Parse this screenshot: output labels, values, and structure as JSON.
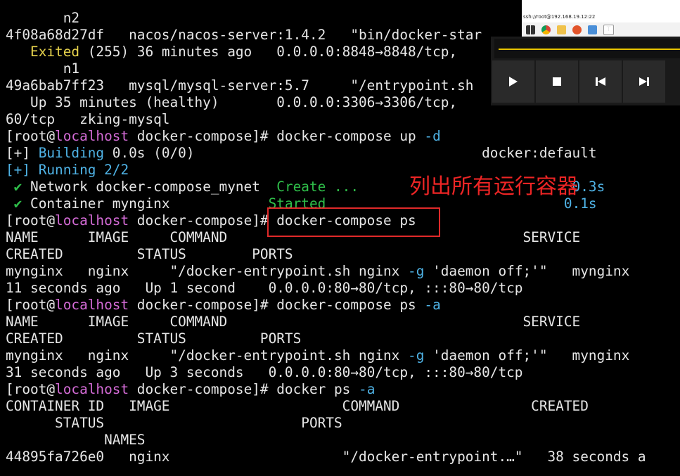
{
  "terminal": {
    "lines": [
      [
        {
          "t": "       n2",
          "c": "c-white"
        }
      ],
      [
        {
          "t": "4f08a68d27df   nacos/nacos-server:1.4.2   \"bin/docker-star",
          "c": "c-white"
        }
      ],
      [
        {
          "t": "   ",
          "c": "c-white"
        },
        {
          "t": "Exited",
          "c": "c-yellow"
        },
        {
          "t": " (255) 36 minutes ago   0.0.0.0:8848→8848/tcp, ",
          "c": "c-white"
        }
      ],
      [
        {
          "t": "       n1",
          "c": "c-white"
        }
      ],
      [
        {
          "t": "49a6bab7ff23   mysql/mysql-server:5.7     \"/entrypoint.sh",
          "c": "c-white"
        }
      ],
      [
        {
          "t": "   Up 35 minutes (healthy)       0.0.0.0:3306→3306/tcp, ",
          "c": "c-white"
        }
      ],
      [
        {
          "t": "60/tcp   zking-mysql",
          "c": "c-white"
        }
      ],
      [
        {
          "t": "[root@",
          "c": "c-prompt"
        },
        {
          "t": "localhost",
          "c": "c-magenta"
        },
        {
          "t": " docker-compose]# docker-compose up ",
          "c": "c-prompt"
        },
        {
          "t": "-d",
          "c": "c-cyan"
        }
      ],
      [
        {
          "t": "[+] ",
          "c": "c-white"
        },
        {
          "t": "Building",
          "c": "c-cyan"
        },
        {
          "t": " 0.0s (0/0)                                   docker:default",
          "c": "c-white"
        }
      ],
      [
        {
          "t": "[+] Running 2/2",
          "c": "c-cyan"
        }
      ],
      [
        {
          "t": " ✔ ",
          "c": "c-green"
        },
        {
          "t": "Network docker-compose_mynet  ",
          "c": "c-white"
        },
        {
          "t": "Create ...",
          "c": "c-green"
        },
        {
          "t": "                          ",
          "c": "c-white"
        },
        {
          "t": "0.3s",
          "c": "c-cyan"
        }
      ],
      [
        {
          "t": " ✔ ",
          "c": "c-green"
        },
        {
          "t": "Container mynginx            ",
          "c": "c-white"
        },
        {
          "t": "Started",
          "c": "c-green"
        },
        {
          "t": "                             ",
          "c": "c-white"
        },
        {
          "t": "0.1s",
          "c": "c-cyan"
        }
      ],
      [
        {
          "t": "[root@",
          "c": "c-prompt"
        },
        {
          "t": "localhost",
          "c": "c-magenta"
        },
        {
          "t": " docker-compose]# docker-compose ps",
          "c": "c-prompt"
        }
      ],
      [
        {
          "t": "NAME      IMAGE     COMMAND                                    SERVICE",
          "c": "c-white"
        }
      ],
      [
        {
          "t": "CREATED         STATUS        PORTS",
          "c": "c-white"
        }
      ],
      [
        {
          "t": "mynginx   nginx     \"/docker-entrypoint.sh nginx ",
          "c": "c-white"
        },
        {
          "t": "-g",
          "c": "c-cyan"
        },
        {
          "t": " 'daemon off;'\"   mynginx",
          "c": "c-white"
        }
      ],
      [
        {
          "t": "11 seconds ago   Up 1 second    0.0.0.0:80→80/tcp, :::80→80/tcp",
          "c": "c-white"
        }
      ],
      [
        {
          "t": "[root@",
          "c": "c-prompt"
        },
        {
          "t": "localhost",
          "c": "c-magenta"
        },
        {
          "t": " docker-compose]# docker-compose ps ",
          "c": "c-prompt"
        },
        {
          "t": "-a",
          "c": "c-cyan"
        }
      ],
      [
        {
          "t": "NAME      IMAGE     COMMAND                                    SERVICE",
          "c": "c-white"
        }
      ],
      [
        {
          "t": "CREATED         STATUS         PORTS",
          "c": "c-white"
        }
      ],
      [
        {
          "t": "mynginx   nginx     \"/docker-entrypoint.sh nginx ",
          "c": "c-white"
        },
        {
          "t": "-g",
          "c": "c-cyan"
        },
        {
          "t": " 'daemon off;'\"   mynginx",
          "c": "c-white"
        }
      ],
      [
        {
          "t": "31 seconds ago   Up 3 seconds   0.0.0.0:80→80/tcp, :::80→80/tcp",
          "c": "c-white"
        }
      ],
      [
        {
          "t": "[root@",
          "c": "c-prompt"
        },
        {
          "t": "localhost",
          "c": "c-magenta"
        },
        {
          "t": " docker-compose]# docker ps ",
          "c": "c-prompt"
        },
        {
          "t": "-a",
          "c": "c-cyan"
        }
      ],
      [
        {
          "t": "CONTAINER ID   IMAGE                     COMMAND                CREATED",
          "c": "c-white"
        }
      ],
      [
        {
          "t": "      STATUS                        PORTS",
          "c": "c-white"
        }
      ],
      [
        {
          "t": "            NAMES",
          "c": "c-white"
        }
      ],
      [
        {
          "t": "44895fa726e0   nginx                     \"/docker-entrypoint.…\"   38 seconds a",
          "c": "c-white"
        }
      ]
    ]
  },
  "annotation": {
    "text": "列出所有运行容器"
  },
  "overlay": {
    "title": "ssh://root@192.168.19.12:22",
    "taskbar_icons": [
      "windows-icon",
      "chrome-icon",
      "explorer-icon",
      "app-icon",
      "terminal-icon",
      "text-icon"
    ],
    "controls": [
      "play-icon",
      "stop-icon",
      "previous-icon",
      "next-icon"
    ],
    "progress_fraction": 1.0,
    "colors": {
      "progress": "#e8c400"
    }
  }
}
